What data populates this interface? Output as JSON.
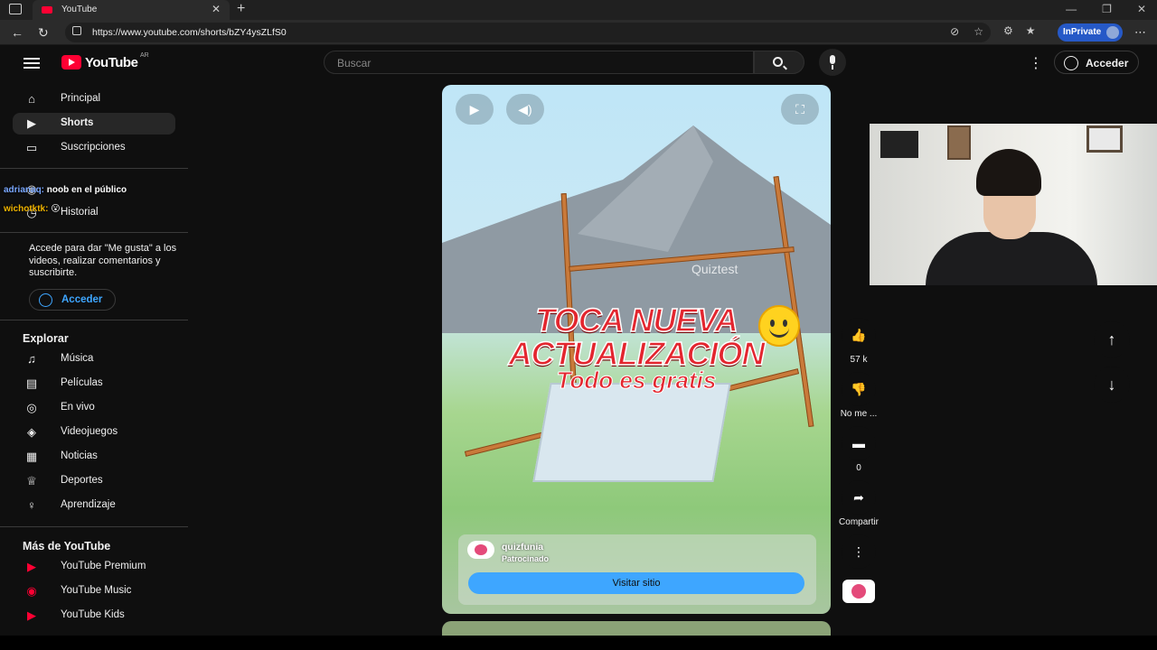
{
  "browser": {
    "tab_title": "YouTube",
    "url": "https://www.youtube.com/shorts/bZY4ysZLfS0",
    "inprivate_label": "InPrivate"
  },
  "header": {
    "logo_text": "YouTube",
    "country": "AR",
    "search_placeholder": "Buscar",
    "signin_label": "Acceder"
  },
  "sidebar": {
    "main_items": [
      {
        "label": "Principal",
        "icon": "home-icon"
      },
      {
        "label": "Shorts",
        "icon": "shorts-icon"
      },
      {
        "label": "Suscripciones",
        "icon": "subscriptions-icon"
      }
    ],
    "you_items": [
      {
        "label": "Tú",
        "icon": "you-icon"
      },
      {
        "label": "Historial",
        "icon": "history-icon"
      }
    ],
    "signin_note": "Accede para dar \"Me gusta\" a los videos, realizar comentarios y suscribirte.",
    "signin_label": "Acceder",
    "explore_title": "Explorar",
    "explore_items": [
      {
        "label": "Música",
        "icon": "music-icon"
      },
      {
        "label": "Películas",
        "icon": "movies-icon"
      },
      {
        "label": "En vivo",
        "icon": "live-icon"
      },
      {
        "label": "Videojuegos",
        "icon": "gaming-icon"
      },
      {
        "label": "Noticias",
        "icon": "news-icon"
      },
      {
        "label": "Deportes",
        "icon": "sports-icon"
      },
      {
        "label": "Aprendizaje",
        "icon": "learning-icon"
      }
    ],
    "more_title": "Más de YouTube",
    "more_items": [
      {
        "label": "YouTube Premium"
      },
      {
        "label": "YouTube Music"
      },
      {
        "label": "YouTube Kids"
      }
    ]
  },
  "chat_overlay": [
    {
      "user": "adrianaq:",
      "message": "noob en el público"
    },
    {
      "user": "wichotktk:",
      "message": "😮"
    }
  ],
  "video": {
    "watermark": "Quiztest",
    "headline_line1": "TOCA NUEVA",
    "headline_line2": "ACTUALIZACIÓN",
    "headline_line3": "Todo es gratis",
    "channel_name": "quizfunia",
    "sponsored": "Patrocinado",
    "visit_label": "Visitar sitio"
  },
  "actions": {
    "likes": "57 k",
    "dislike_label": "No me ...",
    "comments": "0",
    "share_label": "Compartir"
  },
  "colors": {
    "background": "#0f0f0f",
    "brand_red": "#ff0033",
    "link_blue": "#3ea6ff",
    "inprivate_blue": "#2659c7"
  }
}
